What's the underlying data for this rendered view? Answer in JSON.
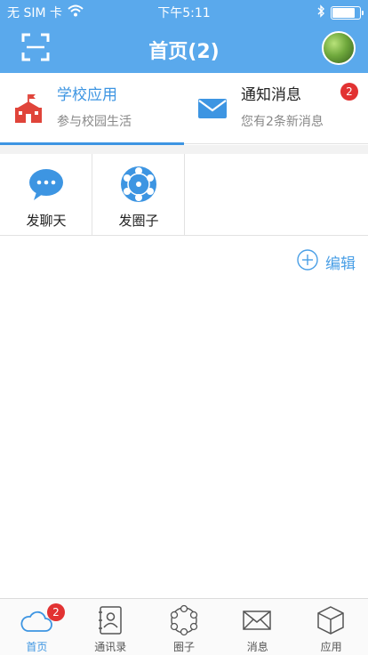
{
  "status_bar": {
    "carrier": "无 SIM 卡",
    "time": "下午5:11",
    "battery_level": 0.85
  },
  "header": {
    "title": "首页(2)",
    "scan_icon": "scan-icon",
    "avatar": "user-avatar"
  },
  "segments": [
    {
      "title": "学校应用",
      "subtitle": "参与校园生活",
      "icon": "school-icon",
      "active": true
    },
    {
      "title": "通知消息",
      "subtitle": "您有2条新消息",
      "icon": "mail-icon",
      "badge": "2",
      "active": false
    }
  ],
  "apps": [
    {
      "label": "发聊天",
      "icon": "chat-bubble-icon"
    },
    {
      "label": "发圈子",
      "icon": "circle-group-icon"
    }
  ],
  "edit_label": "编辑",
  "tabs": [
    {
      "label": "首页",
      "icon": "cloud-icon",
      "badge": "2",
      "active": true
    },
    {
      "label": "通讯录",
      "icon": "contacts-book-icon"
    },
    {
      "label": "圈子",
      "icon": "circle-icon"
    },
    {
      "label": "消息",
      "icon": "envelope-icon"
    },
    {
      "label": "应用",
      "icon": "apps-box-icon"
    }
  ],
  "colors": {
    "header_bg": "#5aa9ec",
    "accent": "#3d95e2",
    "badge": "#e23232",
    "school_icon": "#e0443a"
  }
}
